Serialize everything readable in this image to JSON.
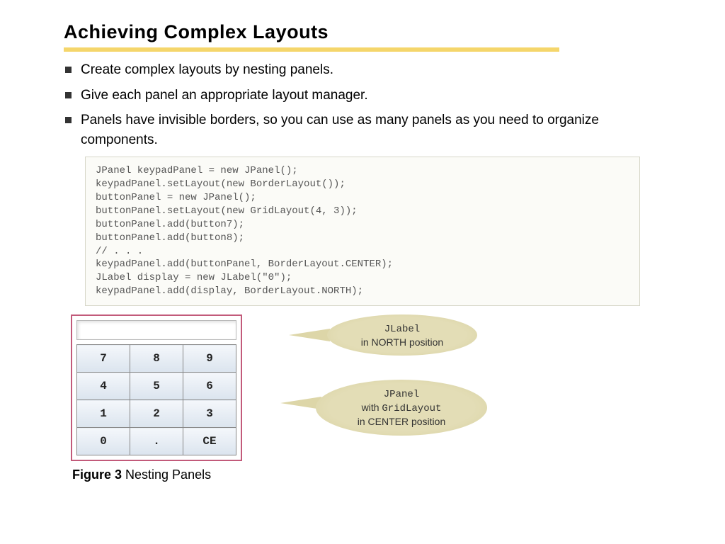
{
  "title": "Achieving Complex Layouts",
  "bullets": [
    "Create complex layouts by nesting panels.",
    "Give each panel an appropriate layout manager.",
    "Panels have invisible borders, so you can use as many panels as you need to organize components."
  ],
  "code": "JPanel keypadPanel = new JPanel();\nkeypadPanel.setLayout(new BorderLayout());\nbuttonPanel = new JPanel();\nbuttonPanel.setLayout(new GridLayout(4, 3));\nbuttonPanel.add(button7);\nbuttonPanel.add(button8);\n// . . .\nkeypadPanel.add(buttonPanel, BorderLayout.CENTER);\nJLabel display = new JLabel(\"0\");\nkeypadPanel.add(display, BorderLayout.NORTH);",
  "keypad": {
    "rows": [
      [
        "7",
        "8",
        "9"
      ],
      [
        "4",
        "5",
        "6"
      ],
      [
        "1",
        "2",
        "3"
      ],
      [
        "0",
        ".",
        "CE"
      ]
    ]
  },
  "callout1": {
    "line1": "JLabel",
    "line2": "in NORTH position"
  },
  "callout2": {
    "line1": "JPanel",
    "line2a": "with ",
    "line2b": "GridLayout",
    "line3": "in CENTER position"
  },
  "figure": {
    "label": "Figure 3",
    "text": " Nesting Panels"
  }
}
